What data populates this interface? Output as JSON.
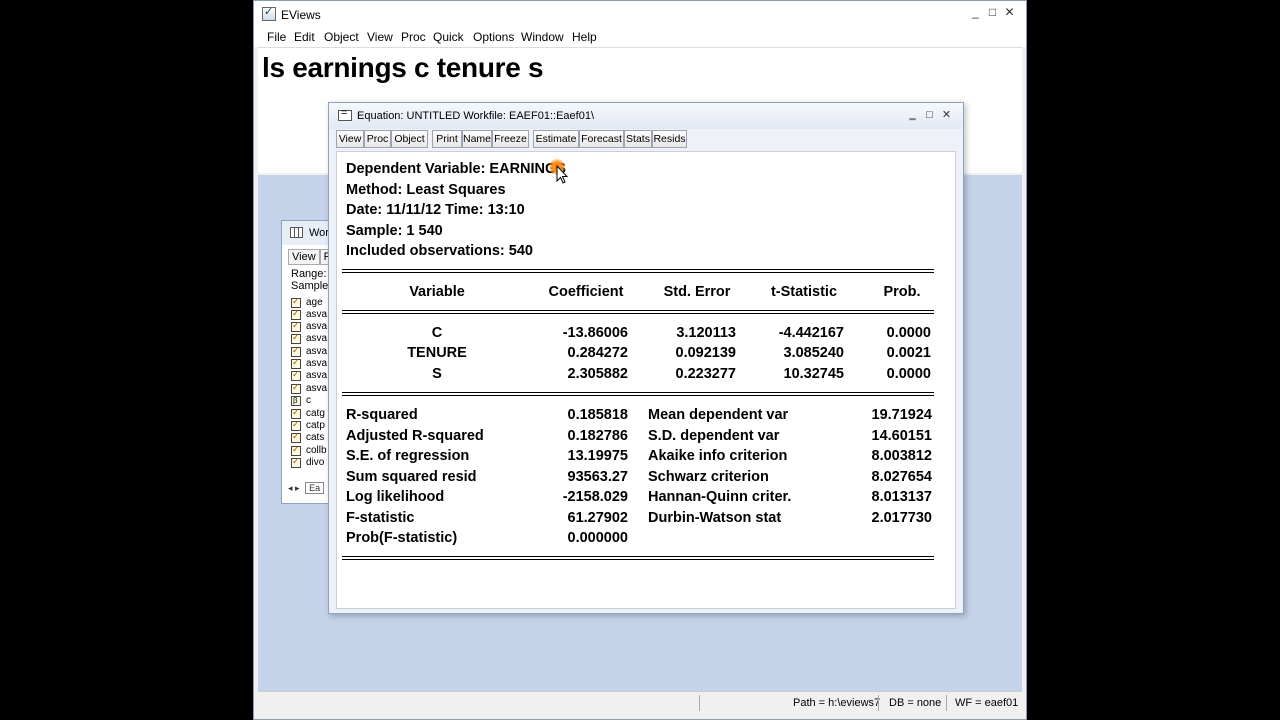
{
  "app": {
    "title": "EViews",
    "window_buttons": [
      "_",
      "□",
      "✕"
    ],
    "menu": [
      "File",
      "Edit",
      "Object",
      "View",
      "Proc",
      "Quick",
      "Options",
      "Window",
      "Help"
    ],
    "command": "ls earnings c tenure s"
  },
  "status": {
    "path": "Path = h:\\eviews7",
    "db": "DB = none",
    "wf": "WF = eaef01"
  },
  "workfile": {
    "title": "Wor",
    "toolbar": [
      "View",
      "Pr"
    ],
    "range_label": "Range:",
    "sample_label": "Sample",
    "items": [
      {
        "name": "age",
        "type": "series"
      },
      {
        "name": "asva",
        "type": "series"
      },
      {
        "name": "asva",
        "type": "series"
      },
      {
        "name": "asva",
        "type": "series"
      },
      {
        "name": "asva",
        "type": "series"
      },
      {
        "name": "asva",
        "type": "series"
      },
      {
        "name": "asva",
        "type": "series"
      },
      {
        "name": "asva",
        "type": "series"
      },
      {
        "name": "c",
        "type": "scalar"
      },
      {
        "name": "catg",
        "type": "series"
      },
      {
        "name": "catp",
        "type": "series"
      },
      {
        "name": "cats",
        "type": "series"
      },
      {
        "name": "collb",
        "type": "series"
      },
      {
        "name": "divo",
        "type": "series"
      }
    ],
    "tab": "Ea"
  },
  "equation": {
    "title": "Equation: UNTITLED   Workfile: EAEF01::Eaef01\\",
    "window_buttons": [
      "‗",
      "□",
      "✕"
    ],
    "toolbar": [
      "View",
      "Proc",
      "Object",
      "Print",
      "Name",
      "Freeze",
      "Estimate",
      "Forecast",
      "Stats",
      "Resids"
    ],
    "header": {
      "dependent": "Dependent Variable: EARNINGS",
      "method": "Method: Least Squares",
      "date": "Date: 11/11/12   Time: 13:10",
      "sample": "Sample: 1 540",
      "obs": "Included observations: 540"
    },
    "columns": [
      "Variable",
      "Coefficient",
      "Std. Error",
      "t-Statistic",
      "Prob."
    ],
    "rows": [
      {
        "variable": "C",
        "coef": "-13.86006",
        "se": "3.120113",
        "t": "-4.442167",
        "p": "0.0000"
      },
      {
        "variable": "TENURE",
        "coef": "0.284272",
        "se": "0.092139",
        "t": "3.085240",
        "p": "0.0021"
      },
      {
        "variable": "S",
        "coef": "2.305882",
        "se": "0.223277",
        "t": "10.32745",
        "p": "0.0000"
      }
    ],
    "stats_left": [
      {
        "label": "R-squared",
        "value": "0.185818"
      },
      {
        "label": "Adjusted R-squared",
        "value": "0.182786"
      },
      {
        "label": "S.E. of regression",
        "value": "13.19975"
      },
      {
        "label": "Sum squared resid",
        "value": "93563.27"
      },
      {
        "label": "Log likelihood",
        "value": "-2158.029"
      },
      {
        "label": "F-statistic",
        "value": "61.27902"
      },
      {
        "label": "Prob(F-statistic)",
        "value": "0.000000"
      }
    ],
    "stats_right": [
      {
        "label": "Mean dependent var",
        "value": "19.71924"
      },
      {
        "label": "S.D. dependent var",
        "value": "14.60151"
      },
      {
        "label": "Akaike info criterion",
        "value": "8.003812"
      },
      {
        "label": "Schwarz criterion",
        "value": "8.027654"
      },
      {
        "label": "Hannan-Quinn criter.",
        "value": "8.013137"
      },
      {
        "label": "Durbin-Watson stat",
        "value": "2.017730"
      }
    ]
  }
}
